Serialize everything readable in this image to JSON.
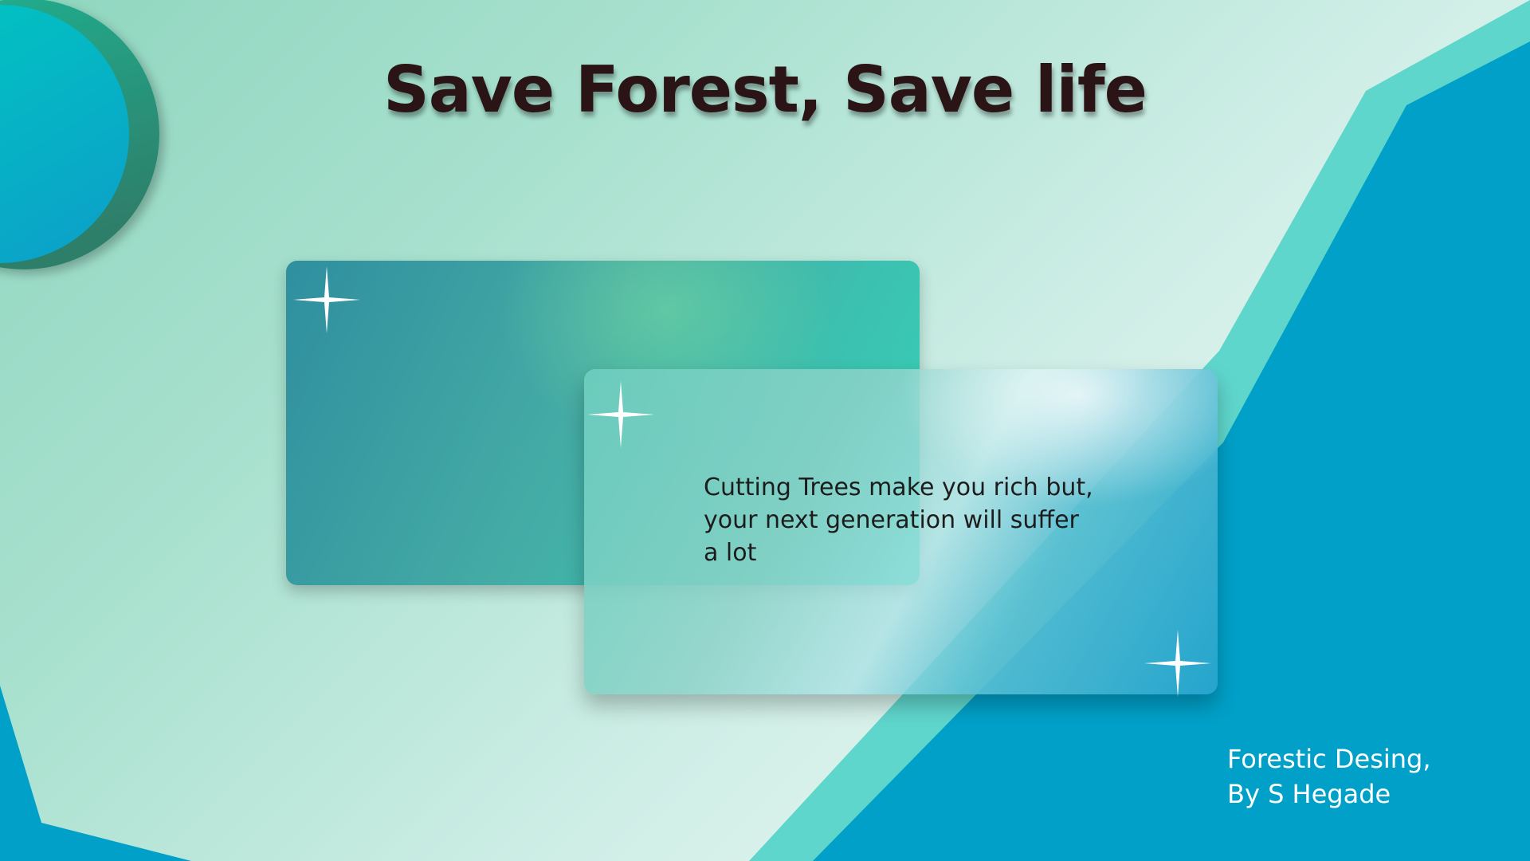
{
  "title": "Save Forest, Save life",
  "card_text_lines": [
    "Cutting Trees make you rich but,",
    "your next generation will suffer",
    "a lot"
  ],
  "credit_lines": [
    "Forestic Desing,",
    "By S Hegade"
  ],
  "icons": [
    "sparkle-icon",
    "sparkle-icon",
    "sparkle-icon"
  ],
  "colors": {
    "title": "#2a1416",
    "blue_panel": "#00a0c8",
    "teal_stripe": "#5fd6cc",
    "circle_front": "#00bcc9",
    "circle_back": "#2a8f7b",
    "credit_text": "#ffffff"
  }
}
